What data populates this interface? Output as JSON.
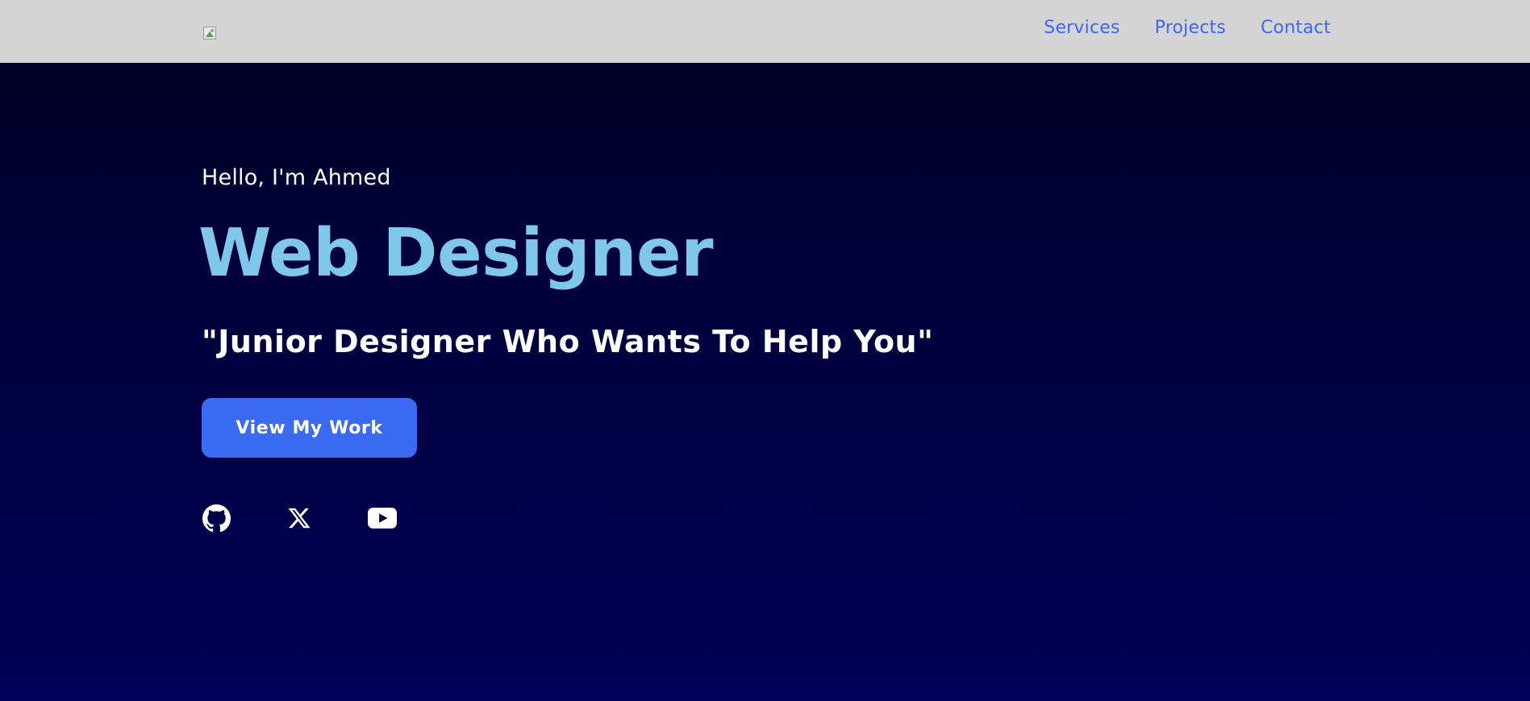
{
  "header": {
    "logo_alt": "",
    "nav": [
      {
        "label": "Services"
      },
      {
        "label": "Projects"
      },
      {
        "label": "Contact"
      }
    ]
  },
  "hero": {
    "greeting": "Hello, I'm Ahmed",
    "title": "Web Designer",
    "tagline": "\"Junior Designer Who Wants To Help You\"",
    "cta_label": "View My Work"
  },
  "socials": [
    {
      "icon": "github-icon"
    },
    {
      "icon": "x-icon"
    },
    {
      "icon": "youtube-icon"
    }
  ],
  "colors": {
    "header_bg": "#d4d4d4",
    "nav_link": "#3d66f0",
    "title": "#80c7ec",
    "button_bg": "#3b6bf2",
    "bg_top": "#000022",
    "bg_bottom": "#010156"
  }
}
